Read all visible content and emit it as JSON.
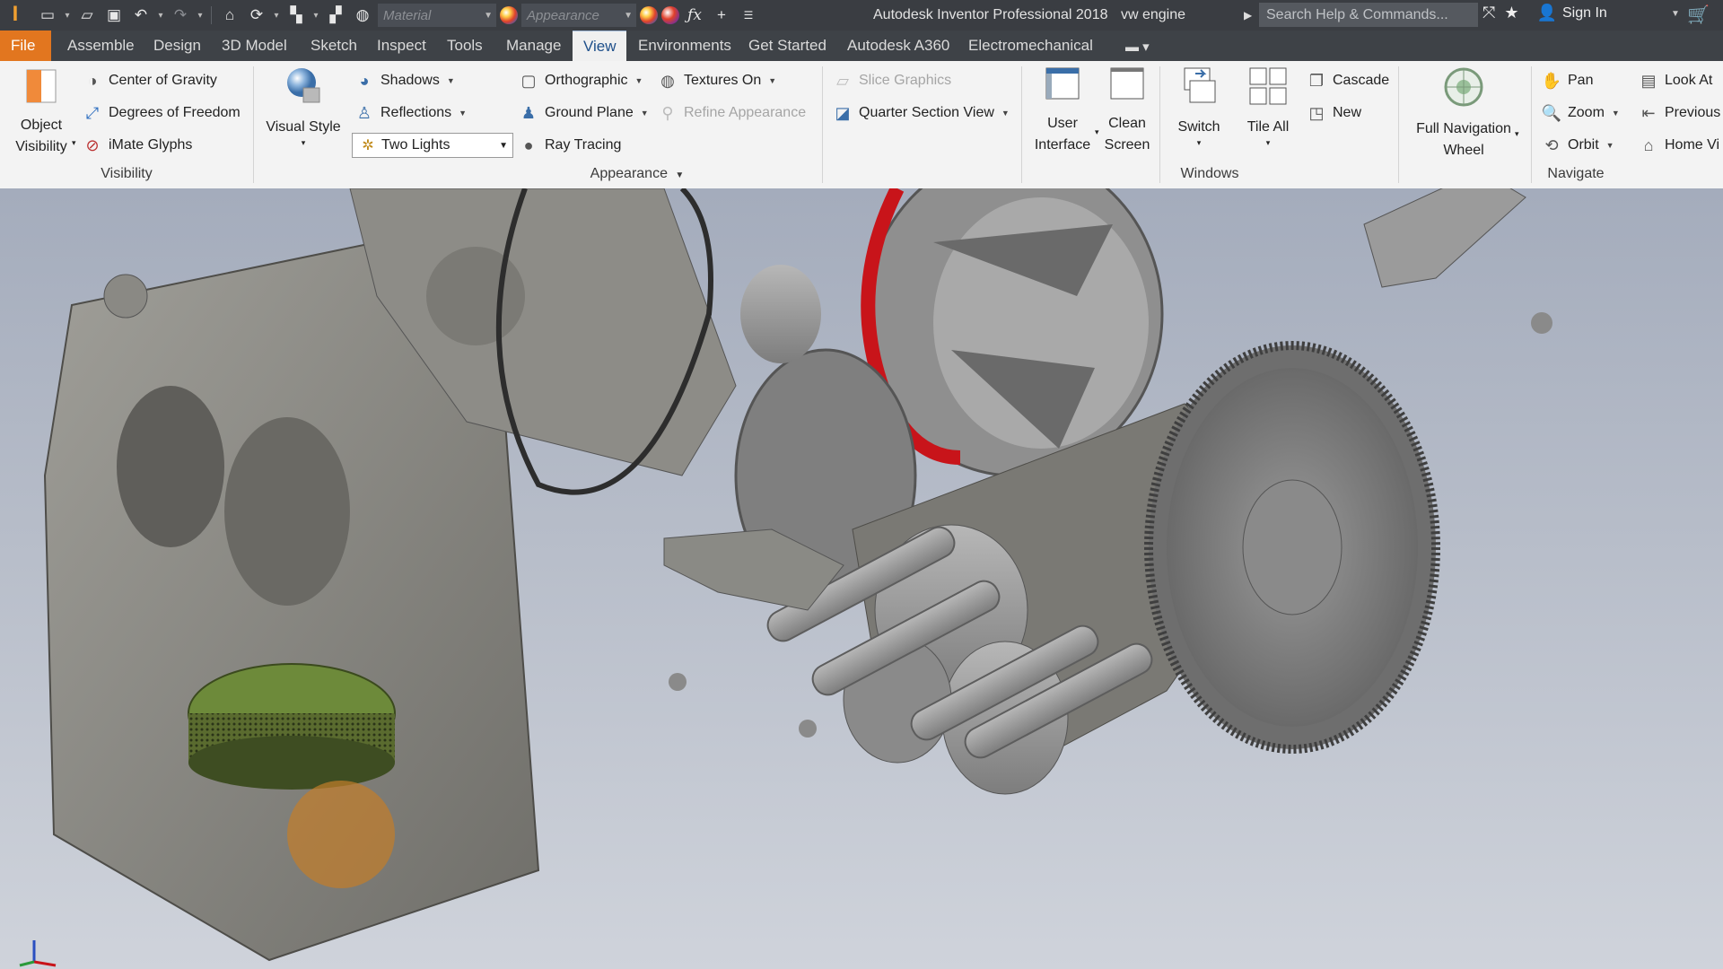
{
  "titlebar": {
    "app_title": "Autodesk Inventor Professional 2018",
    "document_name": "vw engine",
    "material_placeholder": "Material",
    "appearance_placeholder": "Appearance",
    "search_placeholder": "Search Help & Commands...",
    "sign_in": "Sign In"
  },
  "tabs": [
    "File",
    "Assemble",
    "Design",
    "3D Model",
    "Sketch",
    "Inspect",
    "Tools",
    "Manage",
    "View",
    "Environments",
    "Get Started",
    "Autodesk A360",
    "Electromechanical"
  ],
  "active_tab": "View",
  "ribbon": {
    "visibility": {
      "title": "Visibility",
      "object_visibility_line1": "Object",
      "object_visibility_line2": "Visibility",
      "center_of_gravity": "Center of Gravity",
      "degrees_of_freedom": "Degrees of Freedom",
      "imate_glyphs": "iMate Glyphs"
    },
    "appearance": {
      "title": "Appearance",
      "visual_style_line1": "Visual Style",
      "shadows": "Shadows",
      "reflections": "Reflections",
      "lighting_value": "Two Lights",
      "orthographic": "Orthographic",
      "ground_plane": "Ground Plane",
      "ray_tracing": "Ray Tracing",
      "textures_on": "Textures On",
      "refine_appearance": "Refine Appearance",
      "slice_graphics": "Slice Graphics",
      "quarter_section_view": "Quarter Section View"
    },
    "windows": {
      "title": "Windows",
      "user_interface_line1": "User",
      "user_interface_line2": "Interface",
      "clean_screen_line1": "Clean",
      "clean_screen_line2": "Screen",
      "switch": "Switch",
      "tile_all": "Tile All",
      "cascade": "Cascade",
      "new": "New"
    },
    "navigate": {
      "title": "Navigate",
      "full_nav_line1": "Full Navigation",
      "full_nav_line2": "Wheel",
      "pan": "Pan",
      "zoom": "Zoom",
      "orbit": "Orbit",
      "look_at": "Look At",
      "previous": "Previous",
      "home_view": "Home Vi"
    }
  },
  "colors": {
    "titlebar_bg": "#3a3d42",
    "file_tab": "#e2761f",
    "active_tab_text": "#1e4f8a",
    "ribbon_bg": "#f3f3f3",
    "part_gray": "#8c8b86",
    "highlight_red": "#c8141a",
    "filter_green": "#6d8a3a"
  },
  "icons": [
    "inventor-logo",
    "new-file-icon",
    "open-icon",
    "save-icon",
    "undo-icon",
    "redo-icon",
    "home-icon",
    "update-icon",
    "select-icon",
    "measure-icon",
    "globe-icon",
    "color-ball-icon",
    "clear-appearance-icon",
    "fx-icon",
    "plus-icon",
    "customize-icon",
    "star-icon",
    "user-icon",
    "cart-icon"
  ]
}
